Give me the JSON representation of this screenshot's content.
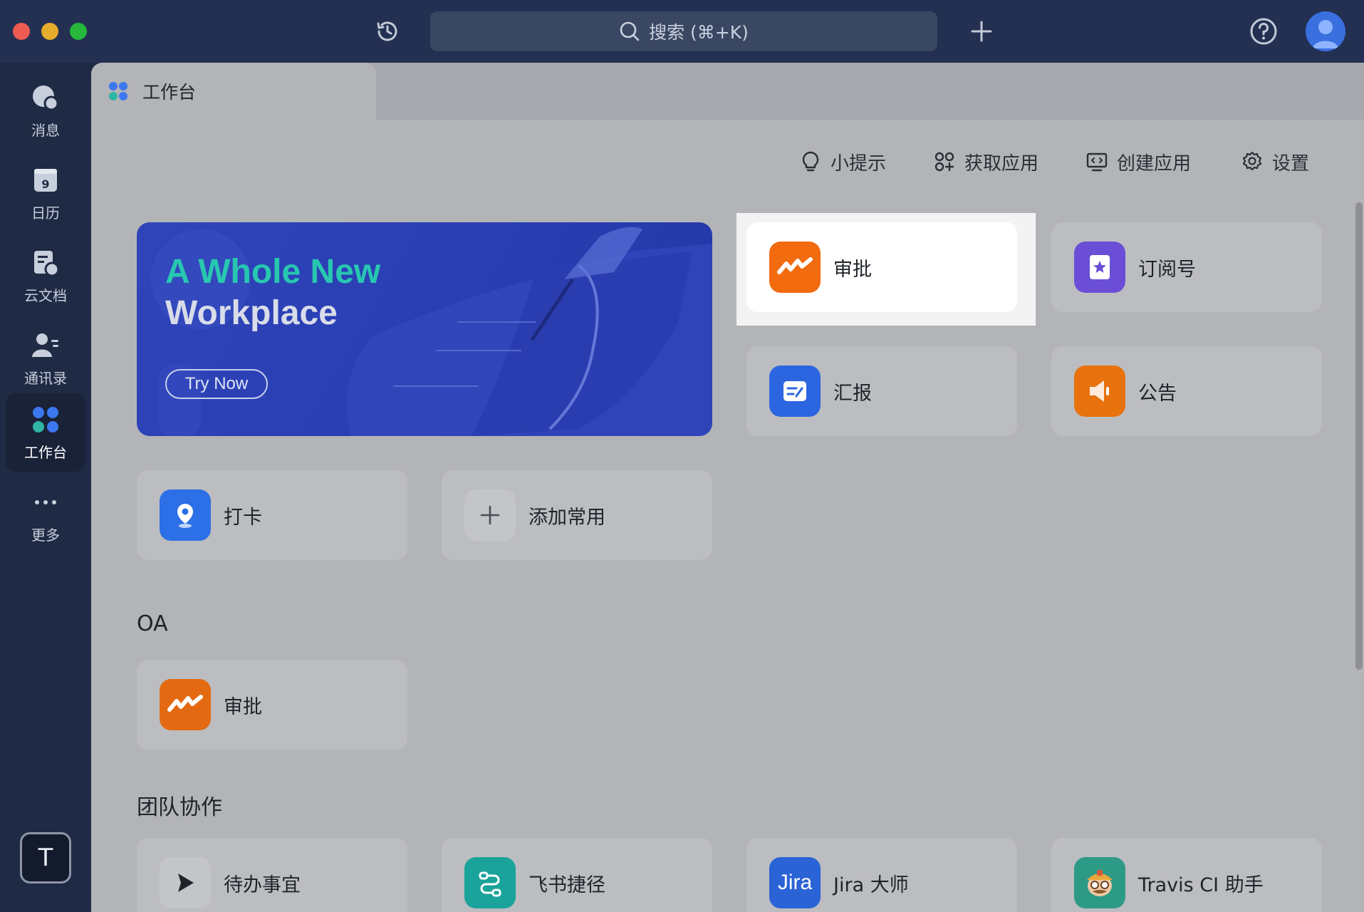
{
  "titlebar": {
    "search_placeholder": "搜索 (⌘+K)"
  },
  "sidebar": {
    "items": [
      {
        "label": "消息"
      },
      {
        "label": "日历",
        "day": "9"
      },
      {
        "label": "云文档"
      },
      {
        "label": "通讯录"
      },
      {
        "label": "工作台"
      },
      {
        "label": "更多"
      }
    ],
    "bottom_initial": "T"
  },
  "tab": {
    "label": "工作台"
  },
  "toolbar": {
    "tips": "小提示",
    "get_apps": "获取应用",
    "create_app": "创建应用",
    "settings": "设置"
  },
  "banner": {
    "line1": "A Whole New",
    "line2": "Workplace",
    "button": "Try Now"
  },
  "favorites": [
    {
      "label": "审批",
      "icon": "approval-icon",
      "color": "#f26b0f"
    },
    {
      "label": "订阅号",
      "icon": "subscription-icon",
      "color": "#6a4fd6"
    },
    {
      "label": "汇报",
      "icon": "report-icon",
      "color": "#2c65e0"
    },
    {
      "label": "公告",
      "icon": "announcement-icon",
      "color": "#e8720e"
    },
    {
      "label": "打卡",
      "icon": "checkin-icon",
      "color": "#2c6fe6"
    },
    {
      "label": "添加常用",
      "icon": "plus-icon",
      "color": "#c4c5c9"
    }
  ],
  "sections": {
    "oa": {
      "title": "OA",
      "apps": [
        {
          "label": "审批",
          "icon": "approval-icon",
          "color": "#e36a12"
        }
      ]
    },
    "team": {
      "title": "团队协作",
      "apps": [
        {
          "label": "待办事宜",
          "icon": "todo-icon",
          "color": "#c4c5c9"
        },
        {
          "label": "飞书捷径",
          "icon": "shortcut-icon",
          "color": "#1aa39a"
        },
        {
          "label": "Jira 大师",
          "icon": "jira-icon",
          "icon_text": "Jira",
          "color": "#2a63d6"
        },
        {
          "label": "Travis CI 助手",
          "icon": "travis-icon",
          "color": "#2d9a86"
        }
      ]
    }
  },
  "colors": {
    "highlight_bg": "#ffffff",
    "banner_accent": "#28c7b0"
  }
}
